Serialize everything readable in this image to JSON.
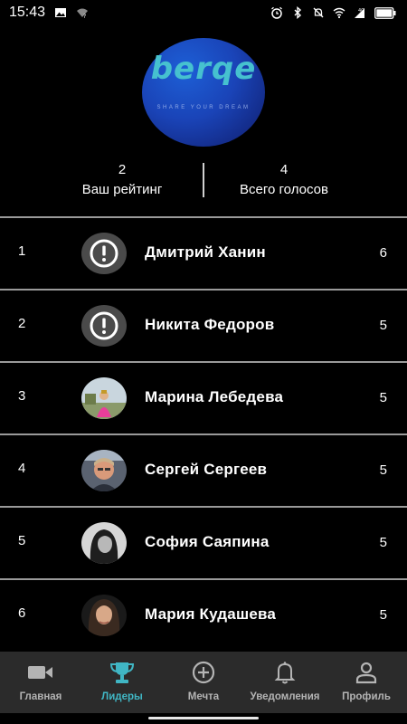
{
  "status_bar": {
    "time": "15:43",
    "network": "4G",
    "left_icons": [
      "image-icon",
      "wifi-unknown-icon"
    ],
    "right_icons": [
      "alarm-icon",
      "bluetooth-icon",
      "mute-icon",
      "wifi-icon",
      "signal-icon",
      "battery-icon"
    ]
  },
  "logo": {
    "word": "berqe",
    "tagline": "SHARE YOUR DREAM"
  },
  "stats": {
    "rating": {
      "value": "2",
      "label": "Ваш рейтинг"
    },
    "votes": {
      "value": "4",
      "label": "Всего голосов"
    }
  },
  "leaders": [
    {
      "rank": "1",
      "name": "Дмитрий Ханин",
      "score": "6",
      "avatar": "alert-icon"
    },
    {
      "rank": "2",
      "name": "Никита Федоров",
      "score": "5",
      "avatar": "alert-icon"
    },
    {
      "rank": "3",
      "name": "Марина Лебедева",
      "score": "5",
      "avatar": "photo"
    },
    {
      "rank": "4",
      "name": "Сергей Сергеев",
      "score": "5",
      "avatar": "photo"
    },
    {
      "rank": "5",
      "name": "София Саяпина",
      "score": "5",
      "avatar": "photo"
    },
    {
      "rank": "6",
      "name": "Мария Кудашева",
      "score": "5",
      "avatar": "photo"
    }
  ],
  "nav": [
    {
      "label": "Главная",
      "icon": "video-camera-icon",
      "active": false
    },
    {
      "label": "Лидеры",
      "icon": "trophy-icon",
      "active": true
    },
    {
      "label": "Мечта",
      "icon": "add-circle-icon",
      "active": false
    },
    {
      "label": "Уведомления",
      "icon": "bell-icon",
      "active": false
    },
    {
      "label": "Профиль",
      "icon": "person-icon",
      "active": false
    }
  ],
  "colors": {
    "background": "#000000",
    "accent": "#40b6c4",
    "nav_background": "#2b2b2b",
    "nav_inactive": "#b4b4b4",
    "logo_blue": "#1a44b8"
  }
}
